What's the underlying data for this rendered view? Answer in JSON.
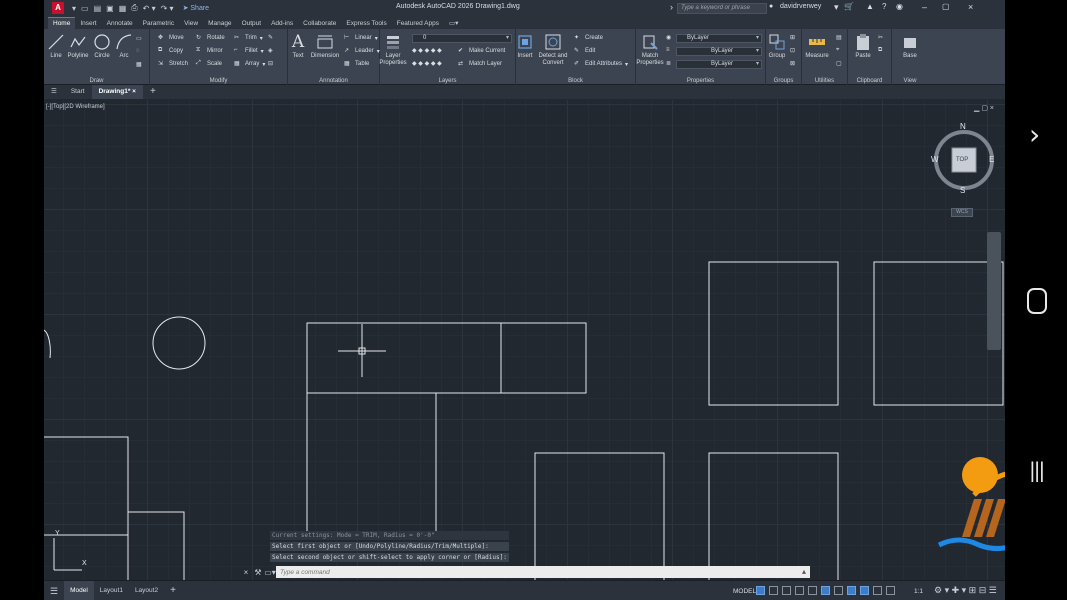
{
  "titlebar": {
    "app_letter": "A",
    "share": "Share",
    "title": "Autodesk AutoCAD 2026    Drawing1.dwg",
    "search_placeholder": "Type a keyword or phrase",
    "user": "davidrverwey"
  },
  "tabs": [
    "Home",
    "Insert",
    "Annotate",
    "Parametric",
    "View",
    "Manage",
    "Output",
    "Add-ins",
    "Collaborate",
    "Express Tools",
    "Featured Apps"
  ],
  "ribbon": {
    "draw": {
      "title": "Draw",
      "line": "Line",
      "polyline": "Polyline",
      "circle": "Circle",
      "arc": "Arc"
    },
    "modify": {
      "title": "Modify",
      "move": "Move",
      "rotate": "Rotate",
      "trim": "Trim",
      "copy": "Copy",
      "mirror": "Mirror",
      "fillet": "Fillet",
      "stretch": "Stretch",
      "scale": "Scale",
      "array": "Array"
    },
    "annotation": {
      "title": "Annotation",
      "text": "Text",
      "dimension": "Dimension",
      "linear": "Linear",
      "leader": "Leader",
      "table": "Table"
    },
    "layers": {
      "title": "Layers",
      "layer_properties": "Layer Properties",
      "layer_value": "0",
      "make_current": "Make Current",
      "match_layer": "Match Layer"
    },
    "block": {
      "title": "Block",
      "insert": "Insert",
      "detect_convert": "Detect and Convert",
      "create": "Create",
      "edit": "Edit",
      "edit_attributes": "Edit Attributes"
    },
    "properties": {
      "title": "Properties",
      "match_properties": "Match Properties",
      "bylayer1": "ByLayer",
      "bylayer2": "ByLayer",
      "bylayer3": "ByLayer"
    },
    "groups": {
      "title": "Groups",
      "group": "Group"
    },
    "utilities": {
      "title": "Utilities",
      "measure": "Measure"
    },
    "clipboard": {
      "title": "Clipboard",
      "paste": "Paste"
    },
    "view": {
      "title": "View",
      "base": "Base"
    }
  },
  "filetabs": {
    "start": "Start",
    "drawing": "Drawing1*"
  },
  "viewport_label": "[-][Top][2D Wireframe]",
  "viewcube": {
    "n": "N",
    "s": "S",
    "e": "E",
    "w": "W",
    "face": "TOP",
    "wcs": "WCS"
  },
  "ucs": {
    "x": "X",
    "y": "Y"
  },
  "command": {
    "history": [
      "Current settings: Mode = TRIM, Radius = 0'-0\"",
      "Select first object or [Undo/Polyline/Radius/Trim/Multiple]:",
      "Select second object or shift-select to apply corner or [Radius]:"
    ],
    "placeholder": "Type a command"
  },
  "statusbar": {
    "model_tab": "Model",
    "layout1": "Layout1",
    "layout2": "Layout2",
    "model_label": "MODEL",
    "scale": "1:1"
  }
}
